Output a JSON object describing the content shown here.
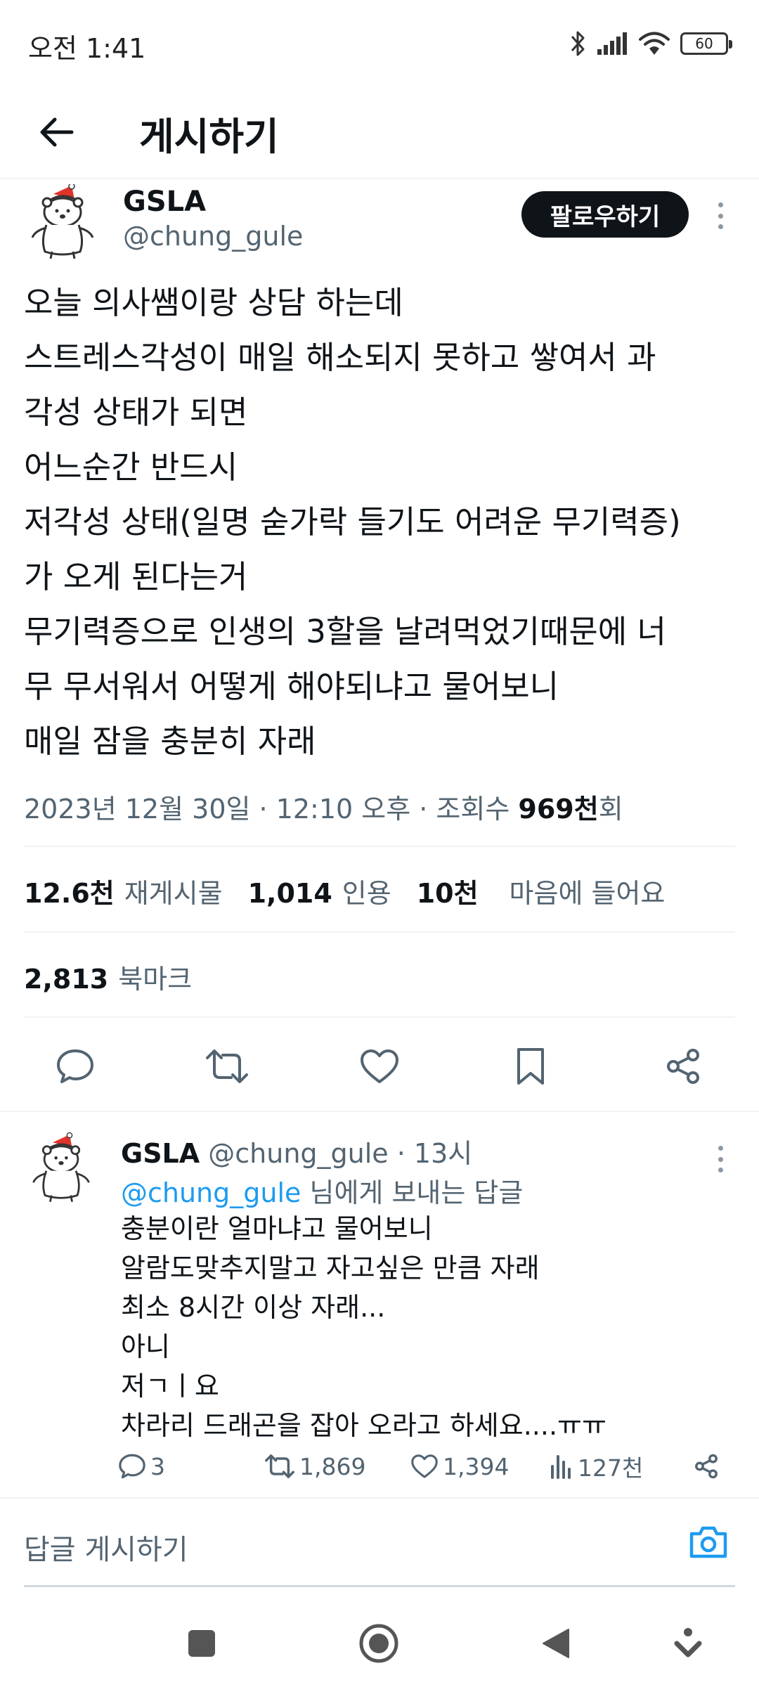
{
  "status": {
    "time": "오전 1:41",
    "battery": "60"
  },
  "topbar": {
    "title": "게시하기"
  },
  "post": {
    "author_name": "GSLA",
    "author_handle": "@chung_gule",
    "follow_label": "팔로우하기",
    "lines": [
      "오늘 의사쌤이랑 상담 하는데",
      "스트레스각성이 매일 해소되지 못하고 쌓여서 과",
      "각성 상태가 되면",
      "어느순간 반드시",
      "저각성 상태(일명 숟가락 들기도 어려운 무기력증)",
      "가 오게 된다는거",
      "무기력증으로 인생의 3할을 날려먹었기때문에 너",
      "무 무서워서 어떻게 해야되냐고 물어보니",
      "매일 잠을 충분히 자래"
    ],
    "timestamp": "2023년 12월 30일 · 12:10 오후 · 조회수 ",
    "views_count": "969천",
    "views_suffix": "회",
    "reposts_count": "12.6천",
    "reposts_label": "재게시물",
    "quotes_count": "1,014",
    "quotes_label": "인용",
    "likes_count": "10천",
    "likes_label": "마음에 들어요",
    "bookmarks_count": "2,813",
    "bookmarks_label": "북마크"
  },
  "reply": {
    "author_name": "GSLA",
    "author_handle_time": " @chung_gule · 13시",
    "reply_to_handle": "@chung_gule",
    "reply_to_suffix": " 님에게 보내는 답글",
    "lines": [
      "충분이란 얼마냐고 물어보니",
      "알람도맞추지말고 자고싶은 만큼 자래",
      "최소 8시간 이상 자래...",
      "아니",
      "저ㄱㅣ요",
      "차라리 드래곤을 잡아 오라고 하세요....ㅠㅠ"
    ],
    "replies": "3",
    "reposts": "1,869",
    "likes": "1,394",
    "views": "127천"
  },
  "composer": {
    "placeholder": "답글 게시하기"
  },
  "colors": {
    "accent": "#1d9bf0",
    "text": "#0f1419",
    "muted": "#536471",
    "divider": "#eff3f4"
  },
  "icons": {
    "back": "arrow-left-icon",
    "reply": "speech-bubble-icon",
    "repost": "repost-arrows-icon",
    "like": "heart-icon",
    "bookmark": "bookmark-icon",
    "share": "share-icon",
    "views": "bar-chart-icon",
    "camera": "camera-icon"
  }
}
